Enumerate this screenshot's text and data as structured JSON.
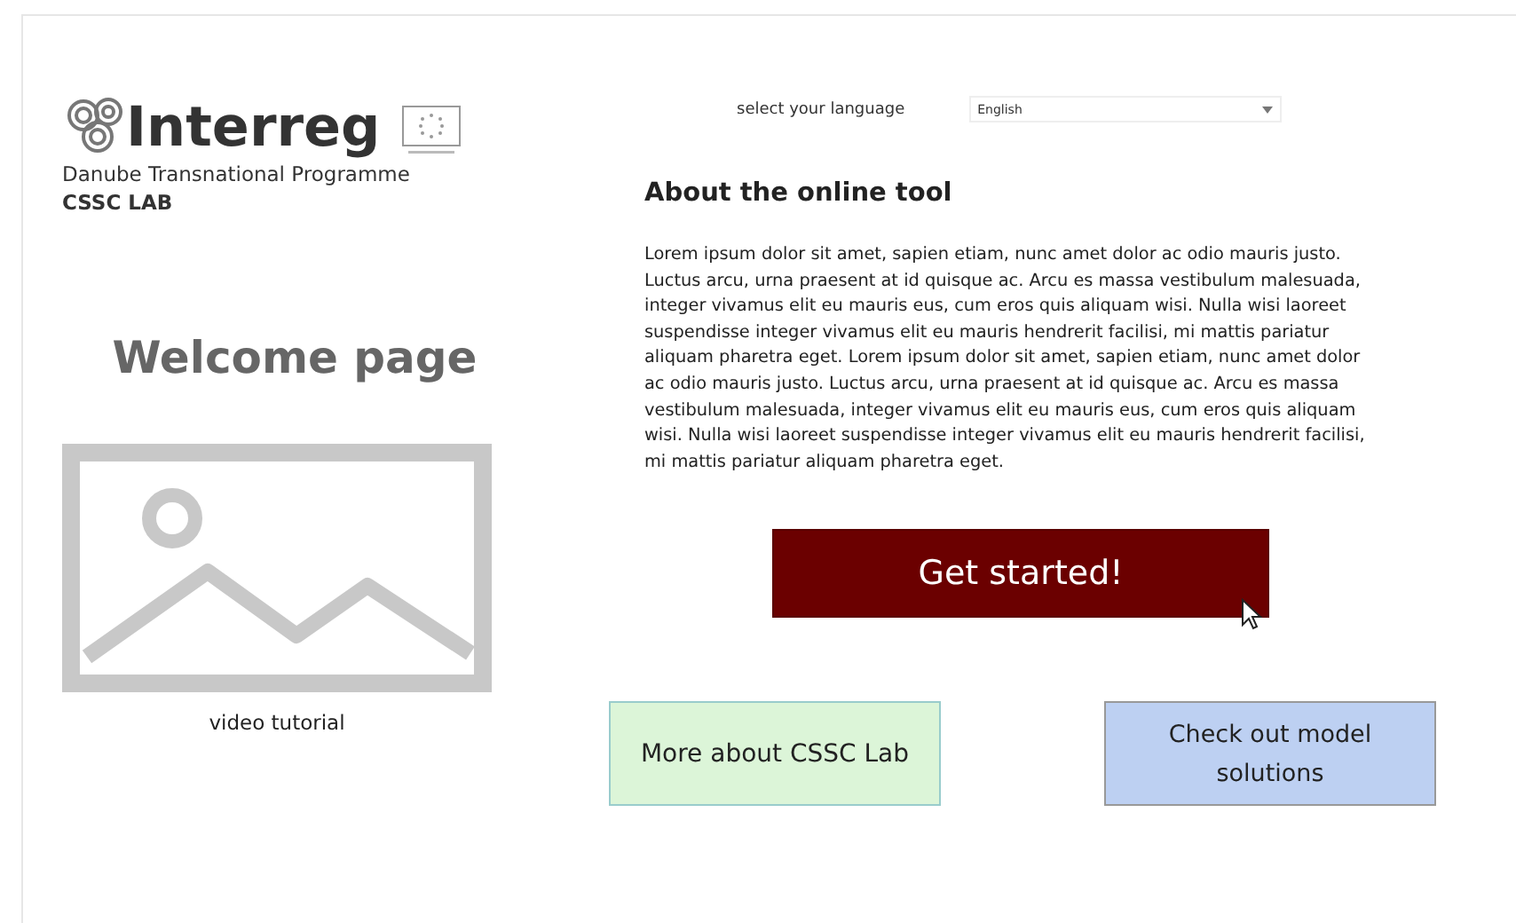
{
  "logo": {
    "wordmark": "Interreg",
    "programme": "Danube Transnational Programme",
    "lab": "CSSC LAB"
  },
  "language": {
    "label": "select your language",
    "value": "English"
  },
  "heading": "Welcome page",
  "video": {
    "caption": "video tutorial"
  },
  "about": {
    "title": "About the online tool",
    "text": "Lorem ipsum dolor sit amet, sapien etiam, nunc amet dolor ac odio mauris justo. Luctus arcu, urna praesent at id quisque ac. Arcu es massa vestibulum malesuada, integer vivamus elit eu mauris eus, cum eros quis aliquam wisi. Nulla wisi laoreet suspendisse integer vivamus elit eu mauris hendrerit facilisi, mi mattis pariatur aliquam pharetra eget. Lorem ipsum dolor sit amet, sapien etiam, nunc amet dolor ac odio mauris justo. Luctus arcu, urna praesent at id quisque ac. Arcu es massa vestibulum malesuada, integer vivamus elit eu mauris eus, cum eros quis aliquam wisi. Nulla wisi laoreet suspendisse integer vivamus elit eu mauris hendrerit facilisi, mi mattis pariatur aliquam pharetra eget."
  },
  "buttons": [
    {
      "label": "Get started!",
      "kind": "primary"
    },
    {
      "label": "More about CSSC Lab",
      "kind": "green"
    },
    {
      "label": "Check out model solutions",
      "kind": "blue"
    }
  ]
}
